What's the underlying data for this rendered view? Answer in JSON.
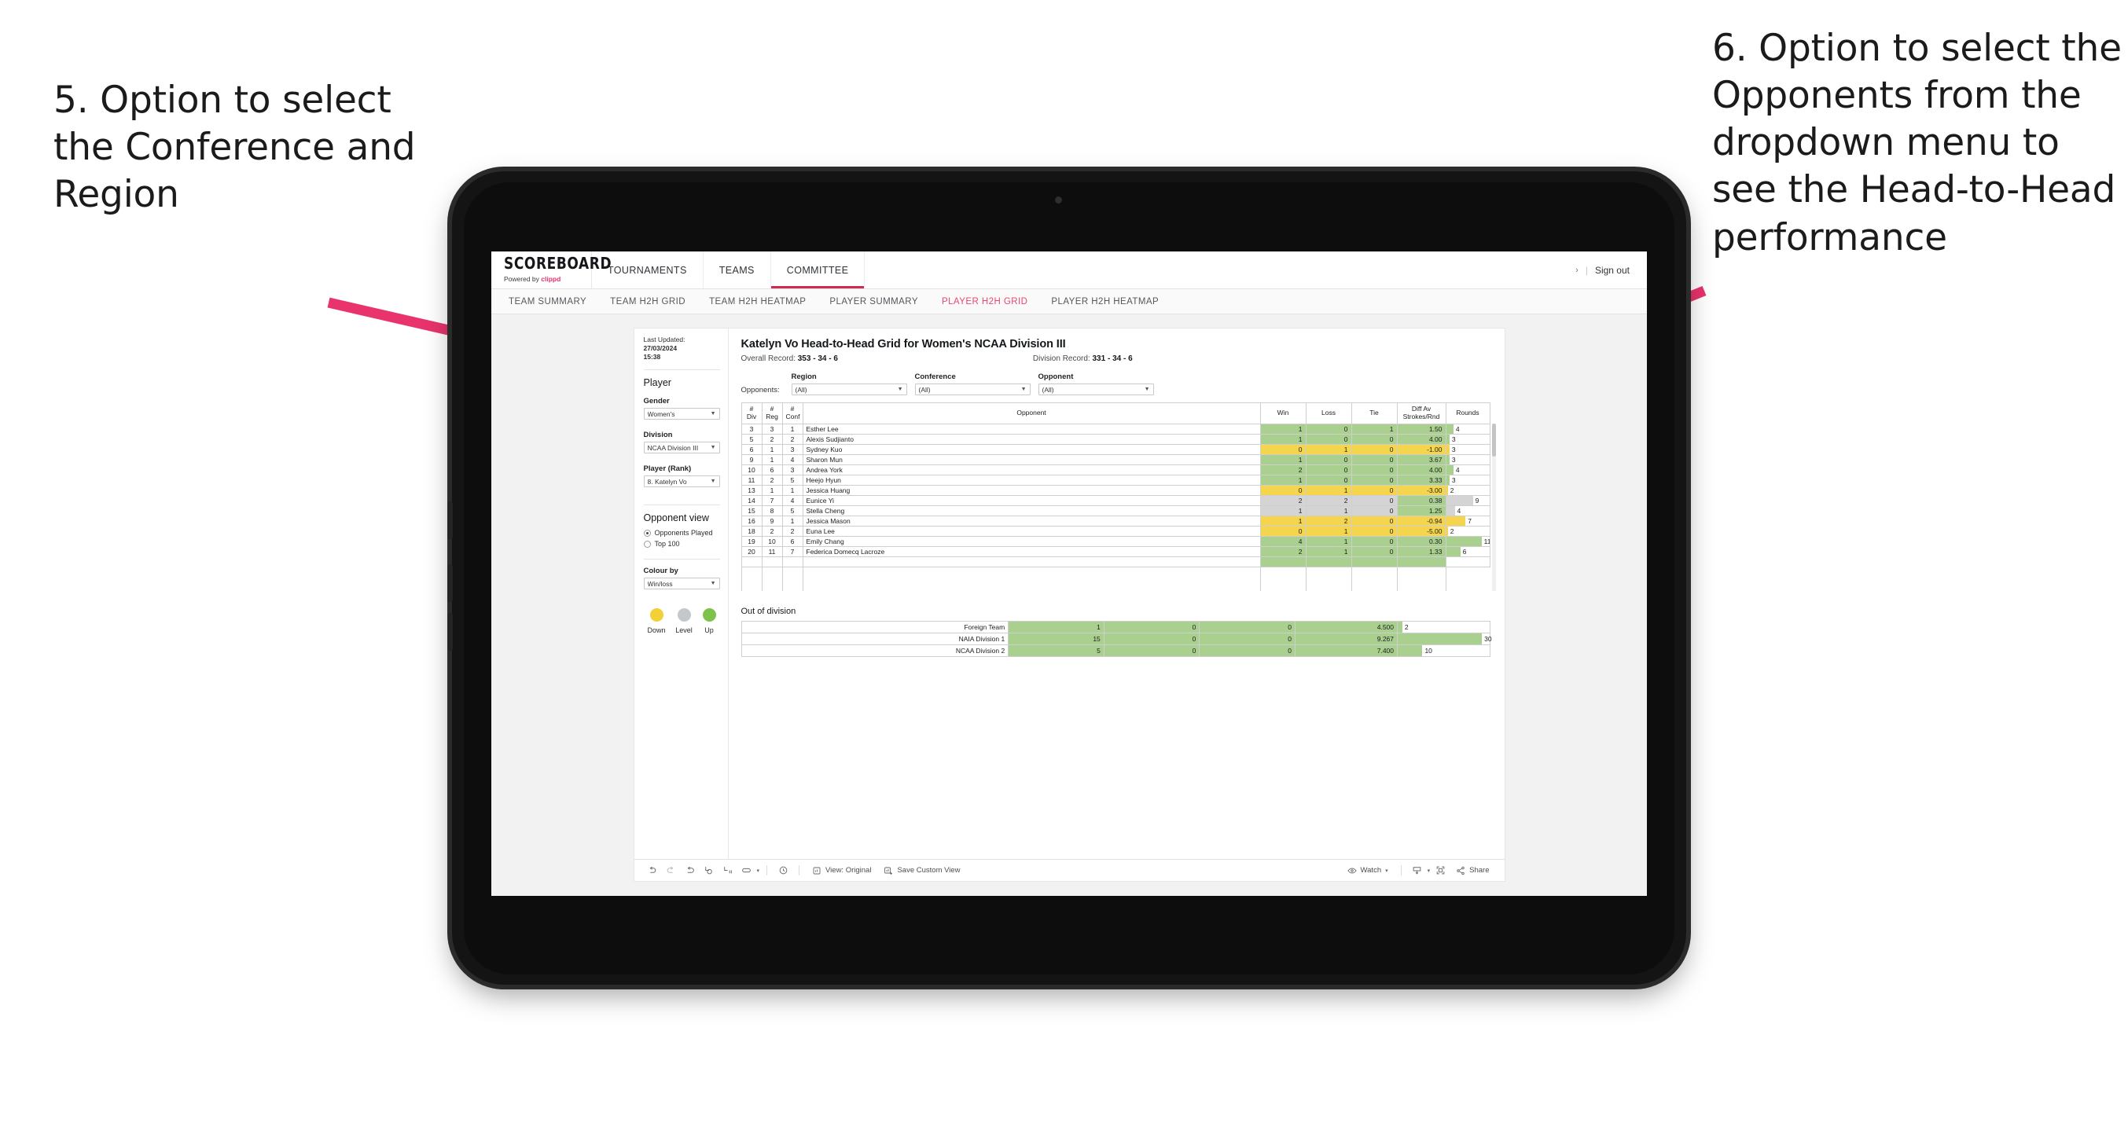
{
  "annotations": {
    "left": "5. Option to select the Conference and Region",
    "right": "6. Option to select the Opponents from the dropdown menu to see the Head-to-Head performance"
  },
  "colors": {
    "accent_pink": "#e8336d",
    "active_tab": "#e8476f",
    "win_green": "#a9d08e",
    "loss_yellow": "#f5d54e",
    "level_grey": "#d4d4d4",
    "legend_down": "#f2d037",
    "legend_level": "#c4c8cc",
    "legend_up": "#7ec24b"
  },
  "app": {
    "brand_name": "SCOREBOARD",
    "brand_sub_prefix": "Powered by ",
    "brand_sub_accent": "clippd",
    "nav": [
      {
        "label": "TOURNAMENTS",
        "active": false
      },
      {
        "label": "TEAMS",
        "active": false
      },
      {
        "label": "COMMITTEE",
        "active": true
      }
    ],
    "account_chevron": "›",
    "separator": "|",
    "sign_out": "Sign out",
    "subtabs": [
      {
        "label": "TEAM SUMMARY",
        "active": false
      },
      {
        "label": "TEAM H2H GRID",
        "active": false
      },
      {
        "label": "TEAM H2H HEATMAP",
        "active": false
      },
      {
        "label": "PLAYER SUMMARY",
        "active": false
      },
      {
        "label": "PLAYER H2H GRID",
        "active": true
      },
      {
        "label": "PLAYER H2H HEATMAP",
        "active": false
      }
    ]
  },
  "sidebar": {
    "last_updated_label": "Last Updated: ",
    "last_updated_value": "27/03/2024",
    "last_updated_time": "15:38",
    "player_section": "Player",
    "gender_label": "Gender",
    "gender_value": "Women's",
    "division_label": "Division",
    "division_value": "NCAA Division III",
    "player_rank_label": "Player (Rank)",
    "player_rank_value": "8. Katelyn Vo",
    "opponent_view_title": "Opponent view",
    "opponent_view_options": [
      {
        "label": "Opponents Played",
        "selected": true
      },
      {
        "label": "Top 100",
        "selected": false
      }
    ],
    "colour_by_label": "Colour by",
    "colour_by_value": "Win/loss",
    "legend": [
      {
        "label": "Down",
        "color": "#f2d037"
      },
      {
        "label": "Level",
        "color": "#c4c8cc"
      },
      {
        "label": "Up",
        "color": "#7ec24b"
      }
    ]
  },
  "main": {
    "title": "Katelyn Vo Head-to-Head Grid for Women's NCAA Division III",
    "overall_record_label": "Overall Record: ",
    "overall_record_value": "353 -  34 - 6",
    "division_record_label": "Division Record: ",
    "division_record_value": "331 -  34 - 6",
    "opponents_label": "Opponents:",
    "filters": [
      {
        "label": "Region",
        "value": "(All)"
      },
      {
        "label": "Conference",
        "value": "(All)"
      },
      {
        "label": "Opponent",
        "value": "(All)"
      }
    ],
    "table_headers": [
      "# Div",
      "# Reg",
      "# Conf",
      "Opponent",
      "Win",
      "Loss",
      "Tie",
      "Diff Av Strokes/Rnd",
      "Rounds"
    ],
    "table_header_lines": {
      "div": [
        "#",
        "Div"
      ],
      "reg": [
        "#",
        "Reg"
      ],
      "conf": [
        "#",
        "Conf"
      ],
      "opponent": [
        "Opponent"
      ],
      "win": [
        "Win"
      ],
      "loss": [
        "Loss"
      ],
      "tie": [
        "Tie"
      ],
      "diff": [
        "Diff Av",
        "Strokes/Rnd"
      ],
      "rounds": [
        "Rounds"
      ]
    },
    "rows": [
      {
        "div": "3",
        "reg": "3",
        "conf": "1",
        "opponent": "Esther Lee",
        "win": "1",
        "loss": "0",
        "tie": "1",
        "diff": "1.50",
        "rounds": "4",
        "tone": "g",
        "bar_pct": 17
      },
      {
        "div": "5",
        "reg": "2",
        "conf": "2",
        "opponent": "Alexis Sudjianto",
        "win": "1",
        "loss": "0",
        "tie": "0",
        "diff": "4.00",
        "rounds": "3",
        "tone": "g",
        "bar_pct": 8
      },
      {
        "div": "6",
        "reg": "1",
        "conf": "3",
        "opponent": "Sydney Kuo",
        "win": "0",
        "loss": "1",
        "tie": "0",
        "diff": "-1.00",
        "rounds": "3",
        "tone": "y",
        "bar_pct": 8
      },
      {
        "div": "9",
        "reg": "1",
        "conf": "4",
        "opponent": "Sharon Mun",
        "win": "1",
        "loss": "0",
        "tie": "0",
        "diff": "3.67",
        "rounds": "3",
        "tone": "g",
        "bar_pct": 8
      },
      {
        "div": "10",
        "reg": "6",
        "conf": "3",
        "opponent": "Andrea York",
        "win": "2",
        "loss": "0",
        "tie": "0",
        "diff": "4.00",
        "rounds": "4",
        "tone": "g",
        "bar_pct": 17
      },
      {
        "div": "11",
        "reg": "2",
        "conf": "5",
        "opponent": "Heejo Hyun",
        "win": "1",
        "loss": "0",
        "tie": "0",
        "diff": "3.33",
        "rounds": "3",
        "tone": "g",
        "bar_pct": 8
      },
      {
        "div": "13",
        "reg": "1",
        "conf": "1",
        "opponent": "Jessica Huang",
        "win": "0",
        "loss": "1",
        "tie": "0",
        "diff": "-3.00",
        "rounds": "2",
        "tone": "y",
        "bar_pct": 4
      },
      {
        "div": "14",
        "reg": "7",
        "conf": "4",
        "opponent": "Eunice Yi",
        "win": "2",
        "loss": "2",
        "tie": "0",
        "diff": "0.38",
        "rounds": "9",
        "tone": "gr",
        "bar_pct": 62,
        "diff_tone": "g"
      },
      {
        "div": "15",
        "reg": "8",
        "conf": "5",
        "opponent": "Stella Cheng",
        "win": "1",
        "loss": "1",
        "tie": "0",
        "diff": "1.25",
        "rounds": "4",
        "tone": "gr",
        "bar_pct": 20,
        "diff_tone": "g"
      },
      {
        "div": "16",
        "reg": "9",
        "conf": "1",
        "opponent": "Jessica Mason",
        "win": "1",
        "loss": "2",
        "tie": "0",
        "diff": "-0.94",
        "rounds": "7",
        "tone": "y",
        "bar_pct": 45
      },
      {
        "div": "18",
        "reg": "2",
        "conf": "2",
        "opponent": "Euna Lee",
        "win": "0",
        "loss": "1",
        "tie": "0",
        "diff": "-5.00",
        "rounds": "2",
        "tone": "y",
        "bar_pct": 4
      },
      {
        "div": "19",
        "reg": "10",
        "conf": "6",
        "opponent": "Emily Chang",
        "win": "4",
        "loss": "1",
        "tie": "0",
        "diff": "0.30",
        "rounds": "11",
        "tone": "g",
        "bar_pct": 82
      },
      {
        "div": "20",
        "reg": "11",
        "conf": "7",
        "opponent": "Federica Domecq Lacroze",
        "win": "2",
        "loss": "1",
        "tie": "0",
        "diff": "1.33",
        "rounds": "6",
        "tone": "g",
        "bar_pct": 33
      }
    ],
    "out_of_division_title": "Out of division",
    "out_of_division_rows": [
      {
        "name": "Foreign Team",
        "win": "1",
        "loss": "0",
        "tie": "0",
        "diff": "4.500",
        "rounds": "2",
        "tone": "g",
        "bar_pct": 5
      },
      {
        "name": "NAIA Division 1",
        "win": "15",
        "loss": "0",
        "tie": "0",
        "diff": "9.267",
        "rounds": "30",
        "tone": "g",
        "bar_pct": 92
      },
      {
        "name": "NCAA Division 2",
        "win": "5",
        "loss": "0",
        "tie": "0",
        "diff": "7.400",
        "rounds": "10",
        "tone": "g",
        "bar_pct": 27
      }
    ]
  },
  "bottombar": {
    "view_label": "View: Original",
    "save_custom_view": "Save Custom View",
    "watch": "Watch",
    "share": "Share",
    "caret": "▾"
  }
}
